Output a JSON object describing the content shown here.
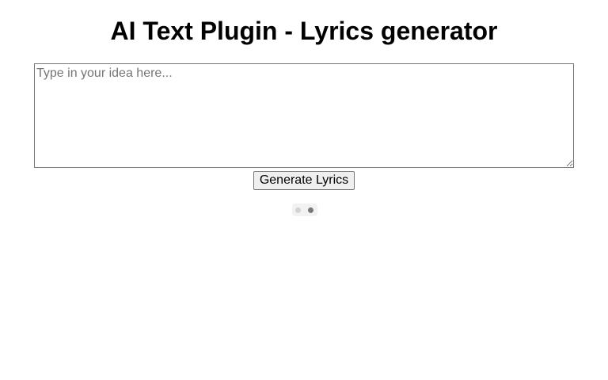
{
  "page": {
    "title": "AI Text Plugin - Lyrics generator"
  },
  "idea_input": {
    "value": "",
    "placeholder": "Type in your idea here..."
  },
  "generate_button": {
    "label": "Generate Lyrics"
  },
  "loader": {
    "icon": "loading-dots-icon",
    "dot_colors": [
      "#d3d3d3",
      "#7a7a7a"
    ]
  }
}
